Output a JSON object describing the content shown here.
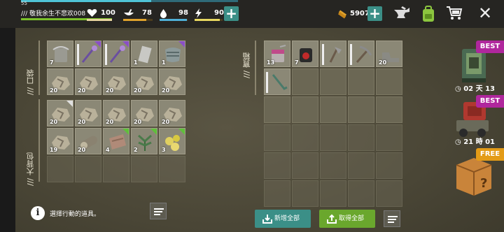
{
  "player": {
    "level": "55",
    "name": "敬我余生不悲欢008",
    "health": "100",
    "food": "78",
    "water": "98",
    "energy": "90"
  },
  "currency": {
    "coins": "5907"
  },
  "sections": {
    "pockets": "口袋",
    "backpack": "大背包",
    "chest": "寶箱"
  },
  "hint": "選擇行動的道具。",
  "buttons": {
    "store_all": "新增全部",
    "take_all": "取得全部"
  },
  "offers": [
    {
      "badge": "BEST",
      "time": "02 天 13"
    },
    {
      "badge": "BEST",
      "time": "21 時 01"
    },
    {
      "badge": "FREE"
    }
  ],
  "pockets_row1": [
    {
      "item": "bucket",
      "count": "7"
    },
    {
      "item": "staff",
      "corner": "purple",
      "bar": true
    },
    {
      "item": "staff",
      "corner": "purple",
      "bar": true
    },
    {
      "item": "plate",
      "count": "1"
    },
    {
      "item": "armor",
      "count": "1",
      "corner": "purple"
    }
  ],
  "pockets_row2": [
    {
      "item": "ore",
      "count": "20"
    },
    {
      "item": "ore",
      "count": "20"
    },
    {
      "item": "ore",
      "count": "20"
    },
    {
      "item": "ore",
      "count": "20"
    },
    {
      "item": "ore",
      "count": "20"
    }
  ],
  "backpack_row1": [
    {
      "item": "ore",
      "count": "20",
      "corner": "white"
    },
    {
      "item": "ore",
      "count": "20"
    },
    {
      "item": "ore",
      "count": "20"
    },
    {
      "item": "ore",
      "count": "20"
    },
    {
      "item": "ore",
      "count": "20"
    }
  ],
  "backpack_row2": [
    {
      "item": "ore",
      "count": "19"
    },
    {
      "item": "log",
      "count": "20"
    },
    {
      "item": "leather",
      "count": "4",
      "corner": "green"
    },
    {
      "item": "herb",
      "count": "2",
      "corner": "green"
    },
    {
      "item": "nuggets",
      "count": "3",
      "corner": "green"
    }
  ],
  "chest_row1": [
    {
      "item": "paint",
      "count": "13"
    },
    {
      "item": "can",
      "count": "7"
    },
    {
      "item": "axe",
      "bar": true
    },
    {
      "item": "pickaxe",
      "bar": true
    },
    {
      "item": "boots",
      "count": "20"
    }
  ],
  "chest_row2": [
    {
      "item": "crowbar",
      "bar": true
    }
  ],
  "colors": {
    "accent": "#3b8f87",
    "green_button": "#6aa72d",
    "best_badge": "#b0279d",
    "free_badge": "#e39b17"
  }
}
